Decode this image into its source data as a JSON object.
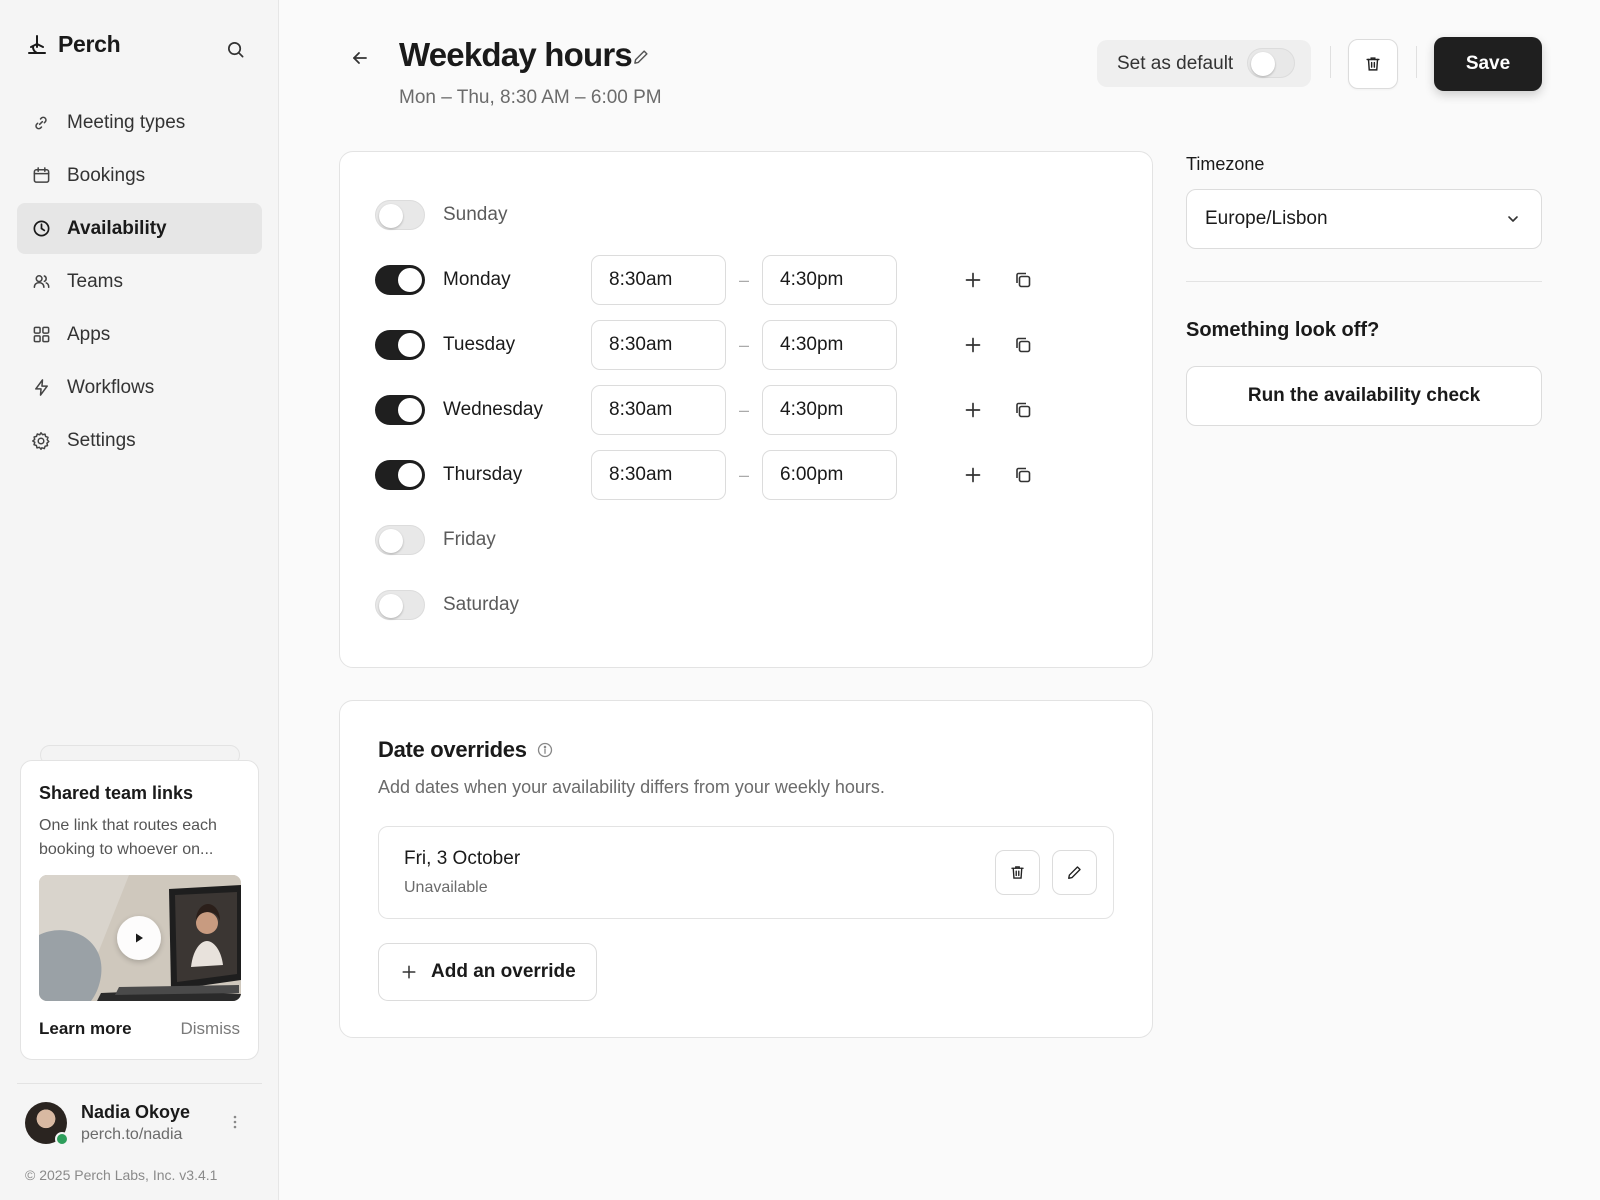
{
  "brand": {
    "name": "Perch"
  },
  "sidebar": {
    "items": [
      {
        "label": "Meeting types",
        "icon": "link-icon",
        "active": false
      },
      {
        "label": "Bookings",
        "icon": "calendar-icon",
        "active": false
      },
      {
        "label": "Availability",
        "icon": "clock-icon",
        "active": true
      },
      {
        "label": "Teams",
        "icon": "users-icon",
        "active": false
      },
      {
        "label": "Apps",
        "icon": "grid-icon",
        "active": false
      },
      {
        "label": "Workflows",
        "icon": "bolt-icon",
        "active": false
      },
      {
        "label": "Settings",
        "icon": "gear-icon",
        "active": false
      }
    ],
    "promo": {
      "title": "Shared team links",
      "text": "One link that routes each booking to whoever on...",
      "learn_more": "Learn more",
      "dismiss": "Dismiss"
    },
    "user": {
      "name": "Nadia Okoye",
      "handle": "perch.to/nadia"
    },
    "copyright": "© 2025 Perch Labs, Inc. v3.4.1"
  },
  "header": {
    "title": "Weekday hours",
    "subtitle": "Mon – Thu, 8:30 AM – 6:00 PM",
    "default_label": "Set as default",
    "default_on": false,
    "save_label": "Save"
  },
  "schedule": {
    "separator": "–",
    "days": [
      {
        "name": "Sunday",
        "enabled": false
      },
      {
        "name": "Monday",
        "enabled": true,
        "start": "8:30am",
        "end": "4:30pm"
      },
      {
        "name": "Tuesday",
        "enabled": true,
        "start": "8:30am",
        "end": "4:30pm"
      },
      {
        "name": "Wednesday",
        "enabled": true,
        "start": "8:30am",
        "end": "4:30pm"
      },
      {
        "name": "Thursday",
        "enabled": true,
        "start": "8:30am",
        "end": "6:00pm"
      },
      {
        "name": "Friday",
        "enabled": false
      },
      {
        "name": "Saturday",
        "enabled": false
      }
    ]
  },
  "overrides": {
    "title": "Date overrides",
    "description": "Add dates when your availability differs from your weekly hours.",
    "items": [
      {
        "date": "Fri, 3 October",
        "status": "Unavailable"
      }
    ],
    "add_label": "Add an override"
  },
  "timezone": {
    "label": "Timezone",
    "value": "Europe/Lisbon"
  },
  "help": {
    "title": "Something look off?",
    "button": "Run the availability check"
  },
  "colors": {
    "accent": "#1f1f1f",
    "status_online": "#2e9e5b"
  }
}
